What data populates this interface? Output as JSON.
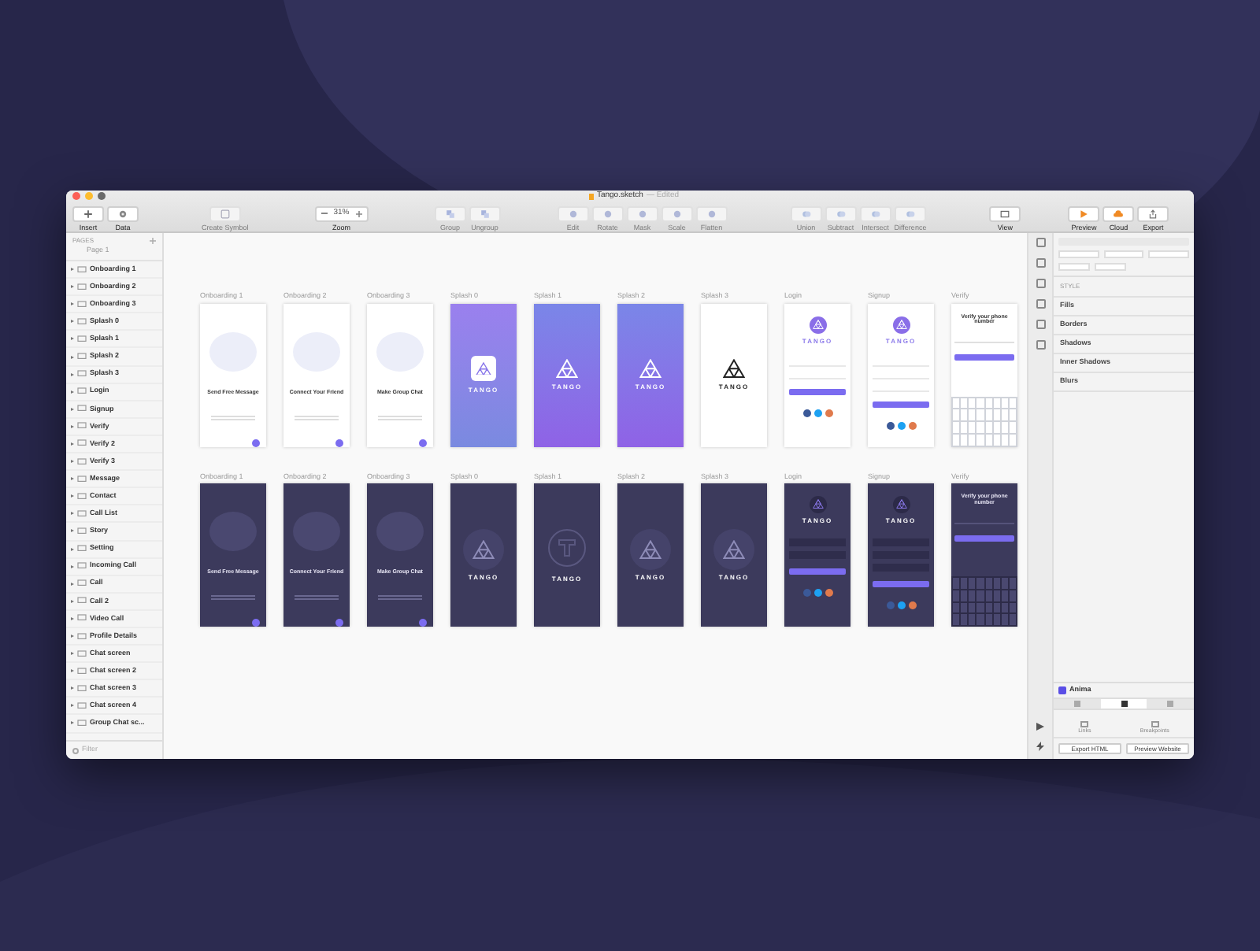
{
  "window": {
    "title": "Tango.sketch",
    "subtitle": "— Edited"
  },
  "toolbar": {
    "zoom": "31%",
    "items": [
      {
        "label": "Insert",
        "kind": "add",
        "disabled": false
      },
      {
        "label": "Data",
        "kind": "gear",
        "disabled": false
      },
      {
        "label": "Create Symbol",
        "kind": "symbol",
        "disabled": true
      },
      {
        "label": "Zoom",
        "kind": "zoom",
        "disabled": false
      },
      {
        "label": "Group",
        "kind": "group",
        "disabled": true
      },
      {
        "label": "Ungroup",
        "kind": "group",
        "disabled": true
      },
      {
        "label": "Edit",
        "kind": "tool",
        "disabled": true
      },
      {
        "label": "Rotate",
        "kind": "tool",
        "disabled": true
      },
      {
        "label": "Mask",
        "kind": "tool",
        "disabled": true
      },
      {
        "label": "Scale",
        "kind": "tool",
        "disabled": true
      },
      {
        "label": "Flatten",
        "kind": "tool",
        "disabled": true
      },
      {
        "label": "Union",
        "kind": "bool",
        "disabled": true
      },
      {
        "label": "Subtract",
        "kind": "bool",
        "disabled": true
      },
      {
        "label": "Intersect",
        "kind": "bool",
        "disabled": true
      },
      {
        "label": "Difference",
        "kind": "bool",
        "disabled": true
      },
      {
        "label": "View",
        "kind": "view",
        "disabled": false
      },
      {
        "label": "Preview",
        "kind": "play",
        "disabled": false
      },
      {
        "label": "Cloud",
        "kind": "cloud",
        "disabled": false
      },
      {
        "label": "Export",
        "kind": "export",
        "disabled": false
      }
    ]
  },
  "sidebar": {
    "heading": "PAGES",
    "page": "Page 1",
    "filter_placeholder": "Filter",
    "layers": [
      "Onboarding 1",
      "Onboarding 2",
      "Onboarding 3",
      "Splash 0",
      "Splash 1",
      "Splash 2",
      "Splash 3",
      "Login",
      "Signup",
      "Verify",
      "Verify 2",
      "Verify 3",
      "Message",
      "Contact",
      "Call List",
      "Story",
      "Setting",
      "Incoming Call",
      "Call",
      "Call 2",
      "Video Call",
      "Profile Details",
      "Chat screen",
      "Chat screen 2",
      "Chat screen 3",
      "Chat screen 4",
      "Group Chat sc..."
    ]
  },
  "canvas": {
    "rows": [
      [
        {
          "label": "Onboarding 1",
          "kind": "onboarding",
          "dark": false,
          "caption": "Send Free Message"
        },
        {
          "label": "Onboarding 2",
          "kind": "onboarding",
          "dark": false,
          "caption": "Connect Your Friend"
        },
        {
          "label": "Onboarding 3",
          "kind": "onboarding",
          "dark": false,
          "caption": "Make Group Chat"
        },
        {
          "label": "Splash 0",
          "kind": "splash-icon",
          "dark": false,
          "caption": "TANGO"
        },
        {
          "label": "Splash 1",
          "kind": "splash-gradient",
          "dark": false,
          "caption": "TANGO"
        },
        {
          "label": "Splash 2",
          "kind": "splash-gradient",
          "dark": false,
          "caption": "TANGO"
        },
        {
          "label": "Splash 3",
          "kind": "splash-plain",
          "dark": false,
          "caption": "TANGO"
        },
        {
          "label": "Login",
          "kind": "login",
          "dark": false,
          "caption": "TANGO"
        },
        {
          "label": "Signup",
          "kind": "signup",
          "dark": false,
          "caption": "TANGO"
        },
        {
          "label": "Verify",
          "kind": "verify",
          "dark": false,
          "caption": "Verify your phone number"
        }
      ],
      [
        {
          "label": "Onboarding 1",
          "kind": "onboarding",
          "dark": true,
          "caption": "Send Free Message"
        },
        {
          "label": "Onboarding 2",
          "kind": "onboarding",
          "dark": true,
          "caption": "Connect Your Friend"
        },
        {
          "label": "Onboarding 3",
          "kind": "onboarding",
          "dark": true,
          "caption": "Make Group Chat"
        },
        {
          "label": "Splash 0",
          "kind": "splash-plain",
          "dark": true,
          "caption": "TANGO"
        },
        {
          "label": "Splash 1",
          "kind": "splash-t",
          "dark": true,
          "caption": "TANGO"
        },
        {
          "label": "Splash 2",
          "kind": "splash-plain",
          "dark": true,
          "caption": "TANGO"
        },
        {
          "label": "Splash 3",
          "kind": "splash-plain",
          "dark": true,
          "caption": "TANGO"
        },
        {
          "label": "Login",
          "kind": "login",
          "dark": true,
          "caption": "TANGO"
        },
        {
          "label": "Signup",
          "kind": "signup",
          "dark": true,
          "caption": "TANGO"
        },
        {
          "label": "Verify",
          "kind": "verify",
          "dark": true,
          "caption": "Verify your phone number"
        }
      ]
    ]
  },
  "inspector": {
    "style_heading": "STYLE",
    "sections": [
      "Fills",
      "Borders",
      "Shadows",
      "Inner Shadows",
      "Blurs"
    ],
    "plugin": {
      "name": "Anima",
      "tabs": [
        {
          "selected": false
        },
        {
          "selected": true
        },
        {
          "selected": false
        }
      ],
      "actions": [
        "Links",
        "Breakpoints"
      ],
      "buttons": [
        "Export HTML",
        "Preview Website"
      ]
    }
  }
}
